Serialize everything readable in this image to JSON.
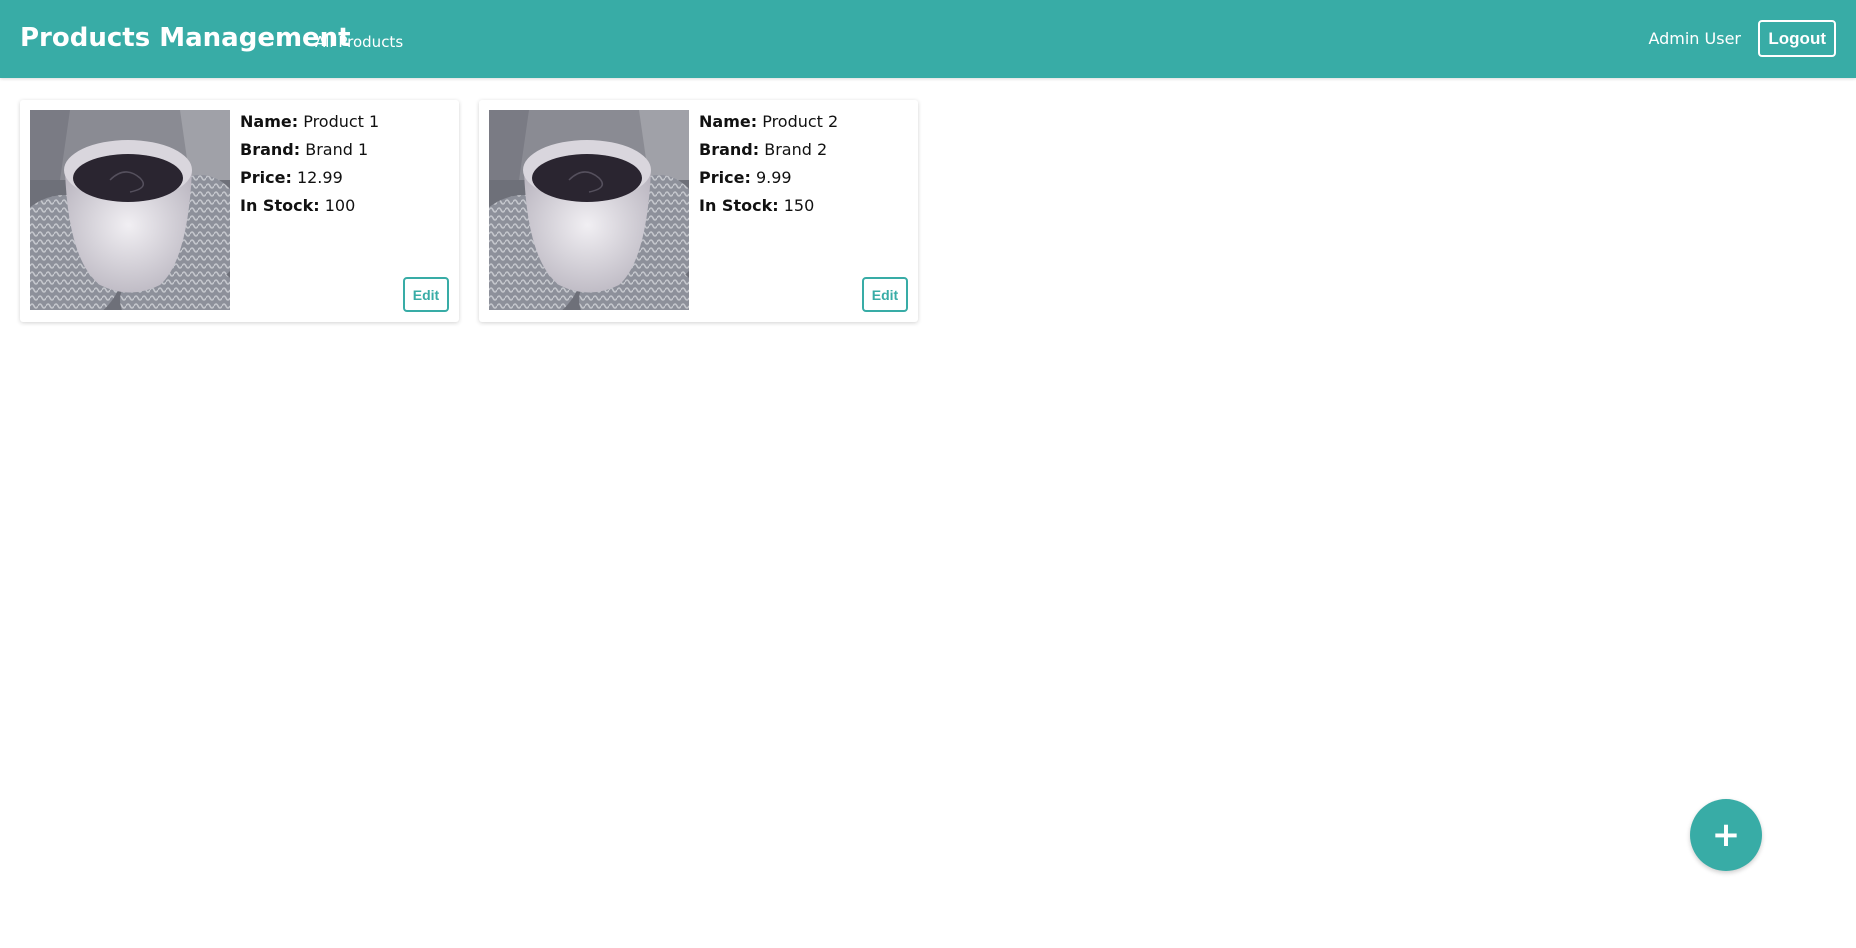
{
  "header": {
    "title": "Products Management",
    "nav_link": "All Products",
    "user": "Admin User",
    "logout_label": "Logout",
    "accent_color": "#38aca6"
  },
  "products": [
    {
      "name_label": "Name:",
      "name": "Product 1",
      "brand_label": "Brand:",
      "brand": "Brand 1",
      "price_label": "Price:",
      "price": "12.99",
      "stock_label": "In Stock:",
      "stock": "100",
      "edit_label": "Edit",
      "image": "coffee-cup-photo"
    },
    {
      "name_label": "Name:",
      "name": "Product 2",
      "brand_label": "Brand:",
      "brand": "Brand 2",
      "price_label": "Price:",
      "price": "9.99",
      "stock_label": "In Stock:",
      "stock": "150",
      "edit_label": "Edit",
      "image": "coffee-cup-photo"
    }
  ],
  "fab": {
    "label": "+",
    "icon": "plus-icon"
  }
}
